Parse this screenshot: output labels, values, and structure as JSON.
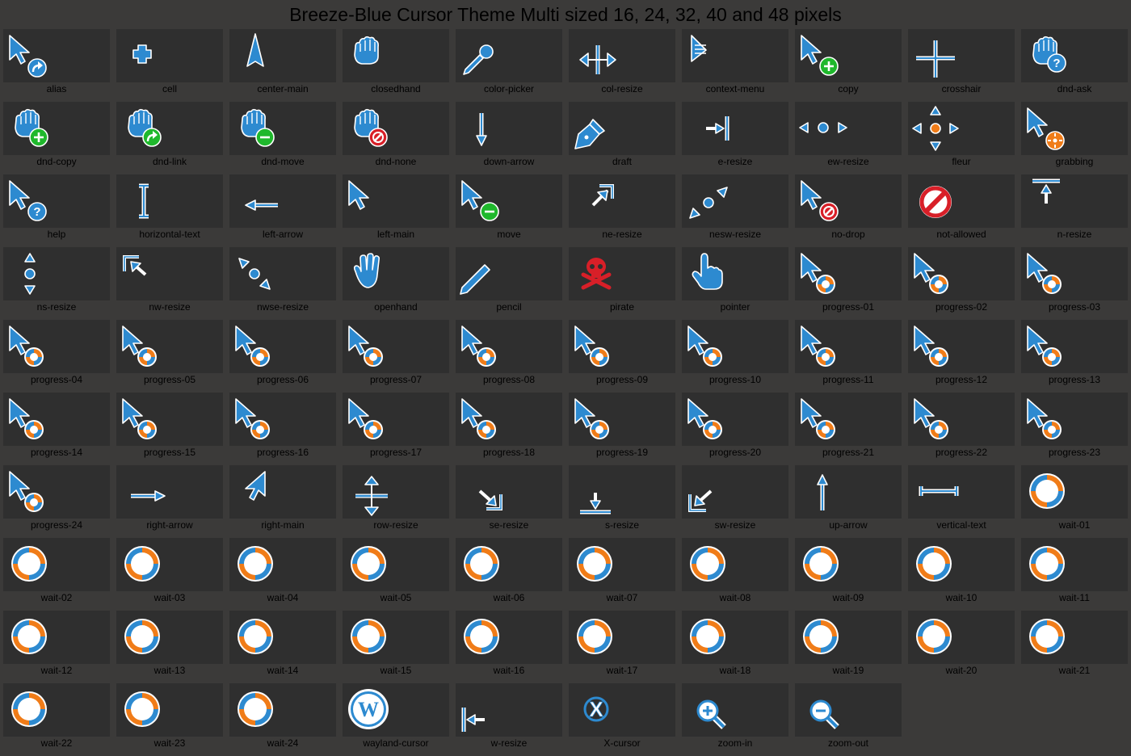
{
  "title": "Breeze-Blue Cursor Theme Multi sized 16, 24, 32, 40 and 48 pixels",
  "colors": {
    "blue": "#2d8ad0",
    "orange": "#f07c18",
    "green": "#1fb82c",
    "red": "#d81f28",
    "outline": "#ffffff"
  },
  "cursors": [
    {
      "name": "alias",
      "icon": "arrow-badge-link"
    },
    {
      "name": "cell",
      "icon": "cell-cross"
    },
    {
      "name": "center-main",
      "icon": "center-arrow"
    },
    {
      "name": "closedhand",
      "icon": "closed-hand"
    },
    {
      "name": "color-picker",
      "icon": "eyedropper"
    },
    {
      "name": "col-resize",
      "icon": "col-resize"
    },
    {
      "name": "context-menu",
      "icon": "arrow-menu"
    },
    {
      "name": "copy",
      "icon": "arrow-badge-plus"
    },
    {
      "name": "crosshair",
      "icon": "crosshair"
    },
    {
      "name": "dnd-ask",
      "icon": "hand-badge-question"
    },
    {
      "name": "dnd-copy",
      "icon": "hand-badge-plus"
    },
    {
      "name": "dnd-link",
      "icon": "hand-badge-link"
    },
    {
      "name": "dnd-move",
      "icon": "hand-badge-minus"
    },
    {
      "name": "dnd-none",
      "icon": "hand-badge-no"
    },
    {
      "name": "down-arrow",
      "icon": "down-arrow"
    },
    {
      "name": "draft",
      "icon": "pen-nib"
    },
    {
      "name": "e-resize",
      "icon": "e-resize"
    },
    {
      "name": "ew-resize",
      "icon": "ew-resize"
    },
    {
      "name": "fleur",
      "icon": "fleur"
    },
    {
      "name": "grabbing",
      "icon": "arrow-badge-move"
    },
    {
      "name": "help",
      "icon": "arrow-badge-question"
    },
    {
      "name": "horizontal-text",
      "icon": "ibeam"
    },
    {
      "name": "left-arrow",
      "icon": "left-arrow"
    },
    {
      "name": "left-main",
      "icon": "arrow"
    },
    {
      "name": "move",
      "icon": "arrow-badge-minus"
    },
    {
      "name": "ne-resize",
      "icon": "ne-resize"
    },
    {
      "name": "nesw-resize",
      "icon": "nesw-resize"
    },
    {
      "name": "no-drop",
      "icon": "arrow-badge-no"
    },
    {
      "name": "not-allowed",
      "icon": "not-allowed"
    },
    {
      "name": "n-resize",
      "icon": "n-resize"
    },
    {
      "name": "ns-resize",
      "icon": "ns-resize"
    },
    {
      "name": "nw-resize",
      "icon": "nw-resize"
    },
    {
      "name": "nwse-resize",
      "icon": "nwse-resize"
    },
    {
      "name": "openhand",
      "icon": "open-hand"
    },
    {
      "name": "pencil",
      "icon": "pencil"
    },
    {
      "name": "pirate",
      "icon": "skull"
    },
    {
      "name": "pointer",
      "icon": "pointing-hand"
    },
    {
      "name": "progress-01",
      "icon": "arrow-progress"
    },
    {
      "name": "progress-02",
      "icon": "arrow-progress"
    },
    {
      "name": "progress-03",
      "icon": "arrow-progress"
    },
    {
      "name": "progress-04",
      "icon": "arrow-progress"
    },
    {
      "name": "progress-05",
      "icon": "arrow-progress"
    },
    {
      "name": "progress-06",
      "icon": "arrow-progress"
    },
    {
      "name": "progress-07",
      "icon": "arrow-progress"
    },
    {
      "name": "progress-08",
      "icon": "arrow-progress"
    },
    {
      "name": "progress-09",
      "icon": "arrow-progress"
    },
    {
      "name": "progress-10",
      "icon": "arrow-progress"
    },
    {
      "name": "progress-11",
      "icon": "arrow-progress"
    },
    {
      "name": "progress-12",
      "icon": "arrow-progress"
    },
    {
      "name": "progress-13",
      "icon": "arrow-progress"
    },
    {
      "name": "progress-14",
      "icon": "arrow-progress"
    },
    {
      "name": "progress-15",
      "icon": "arrow-progress"
    },
    {
      "name": "progress-16",
      "icon": "arrow-progress"
    },
    {
      "name": "progress-17",
      "icon": "arrow-progress"
    },
    {
      "name": "progress-18",
      "icon": "arrow-progress"
    },
    {
      "name": "progress-19",
      "icon": "arrow-progress"
    },
    {
      "name": "progress-20",
      "icon": "arrow-progress"
    },
    {
      "name": "progress-21",
      "icon": "arrow-progress"
    },
    {
      "name": "progress-22",
      "icon": "arrow-progress"
    },
    {
      "name": "progress-23",
      "icon": "arrow-progress"
    },
    {
      "name": "progress-24",
      "icon": "arrow-progress"
    },
    {
      "name": "right-arrow",
      "icon": "right-arrow"
    },
    {
      "name": "right-main",
      "icon": "arrow-mirrored"
    },
    {
      "name": "row-resize",
      "icon": "row-resize"
    },
    {
      "name": "se-resize",
      "icon": "se-resize"
    },
    {
      "name": "s-resize",
      "icon": "s-resize"
    },
    {
      "name": "sw-resize",
      "icon": "sw-resize"
    },
    {
      "name": "up-arrow",
      "icon": "up-arrow"
    },
    {
      "name": "vertical-text",
      "icon": "ibeam-horizontal"
    },
    {
      "name": "wait-01",
      "icon": "wait-spinner"
    },
    {
      "name": "wait-02",
      "icon": "wait-spinner"
    },
    {
      "name": "wait-03",
      "icon": "wait-spinner"
    },
    {
      "name": "wait-04",
      "icon": "wait-spinner"
    },
    {
      "name": "wait-05",
      "icon": "wait-spinner"
    },
    {
      "name": "wait-06",
      "icon": "wait-spinner"
    },
    {
      "name": "wait-07",
      "icon": "wait-spinner"
    },
    {
      "name": "wait-08",
      "icon": "wait-spinner"
    },
    {
      "name": "wait-09",
      "icon": "wait-spinner"
    },
    {
      "name": "wait-10",
      "icon": "wait-spinner"
    },
    {
      "name": "wait-11",
      "icon": "wait-spinner"
    },
    {
      "name": "wait-12",
      "icon": "wait-spinner"
    },
    {
      "name": "wait-13",
      "icon": "wait-spinner"
    },
    {
      "name": "wait-14",
      "icon": "wait-spinner"
    },
    {
      "name": "wait-15",
      "icon": "wait-spinner"
    },
    {
      "name": "wait-16",
      "icon": "wait-spinner"
    },
    {
      "name": "wait-17",
      "icon": "wait-spinner"
    },
    {
      "name": "wait-18",
      "icon": "wait-spinner"
    },
    {
      "name": "wait-19",
      "icon": "wait-spinner"
    },
    {
      "name": "wait-20",
      "icon": "wait-spinner"
    },
    {
      "name": "wait-21",
      "icon": "wait-spinner"
    },
    {
      "name": "wait-22",
      "icon": "wait-spinner"
    },
    {
      "name": "wait-23",
      "icon": "wait-spinner"
    },
    {
      "name": "wait-24",
      "icon": "wait-spinner"
    },
    {
      "name": "wayland-cursor",
      "icon": "wayland-logo"
    },
    {
      "name": "w-resize",
      "icon": "w-resize"
    },
    {
      "name": "X-cursor",
      "icon": "x-logo"
    },
    {
      "name": "zoom-in",
      "icon": "magnifier-plus"
    },
    {
      "name": "zoom-out",
      "icon": "magnifier-minus"
    }
  ]
}
